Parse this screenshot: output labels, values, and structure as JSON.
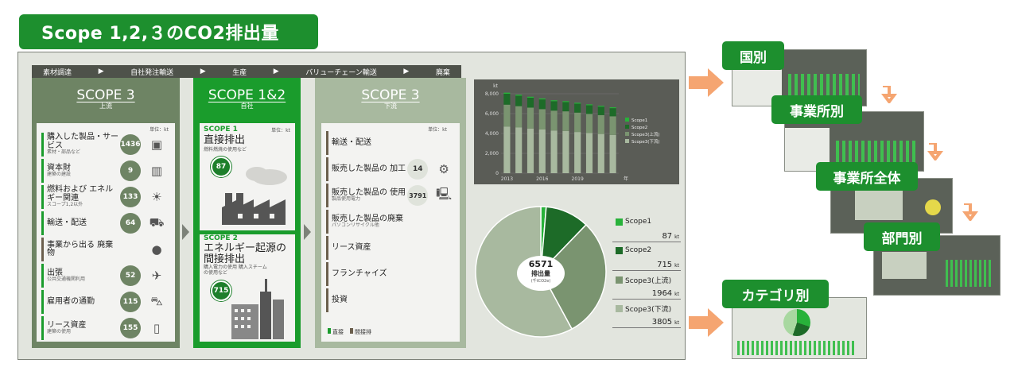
{
  "title": "Scope 1,2,３のCO2排出量",
  "process_steps": [
    "素材調達",
    "自社発注輸送",
    "生産",
    "バリューチェーン輸送",
    "廃棄"
  ],
  "step_arrow": "▶",
  "columns": {
    "upstream": {
      "title": "SCOPE 3",
      "sub": "上流",
      "unit": "単位：kt",
      "rows": [
        {
          "label": "購入した製品・サービス",
          "note": "素材・部品など",
          "value": "1436"
        },
        {
          "label": "資本財",
          "note": "建築の建設",
          "value": "9"
        },
        {
          "label": "燃料および エネルギー関連",
          "note": "スコープ1,2以外",
          "value": "133"
        },
        {
          "label": "輸送・配送",
          "note": "",
          "value": "64"
        },
        {
          "label": "事業から出る 廃棄物",
          "note": "",
          "value": ""
        },
        {
          "label": "出張",
          "note": "公共交通機関利用",
          "value": "52"
        },
        {
          "label": "雇用者の通勤",
          "note": "",
          "value": "115"
        },
        {
          "label": "リース資産",
          "note": "建築の使用",
          "value": "155"
        }
      ]
    },
    "own": {
      "title": "SCOPE 1&2",
      "sub": "自社",
      "unit": "単位：kt",
      "scope1": {
        "tag": "SCOPE 1",
        "label": "直接排出",
        "note": "燃料燃焼の使用など",
        "value": "87"
      },
      "scope2": {
        "tag": "SCOPE 2",
        "label": "エネルギー起源の 間接排出",
        "note": "購入電力の使用 購入スチームの使用など",
        "value": "715"
      }
    },
    "downstream": {
      "title": "SCOPE 3",
      "sub": "下流",
      "unit": "単位：kt",
      "rows": [
        {
          "label": "輸送・配送",
          "note": "",
          "value": ""
        },
        {
          "label": "販売した製品の 加工",
          "note": "",
          "value": "14"
        },
        {
          "label": "販売した製品の 使用",
          "note": "製品使用電力",
          "value": "3791"
        },
        {
          "label": "販売した製品の廃棄",
          "note": "パソコンリサイクル他",
          "value": ""
        },
        {
          "label": "リース資産",
          "note": "",
          "value": ""
        },
        {
          "label": "フランチャイズ",
          "note": "",
          "value": ""
        },
        {
          "label": "投資",
          "note": "",
          "value": ""
        }
      ],
      "legend": [
        "直接",
        "間接排"
      ]
    }
  },
  "chart_data": [
    {
      "type": "bar",
      "stacked": true,
      "title": "",
      "x": [
        2013,
        2014,
        2015,
        2016,
        2017,
        2018,
        2019,
        2020,
        2021,
        2022
      ],
      "x_tick_labels": [
        "2013",
        "2016",
        "2019"
      ],
      "x_unit": "年",
      "y_unit": "kt",
      "ylim": [
        0,
        8000
      ],
      "y_ticks": [
        "0",
        "2,000",
        "4,000",
        "6,000",
        "8,000"
      ],
      "series": [
        {
          "name": "Scope3(下流)",
          "color": "#a8b99f",
          "values": [
            4700,
            4600,
            4500,
            4400,
            4300,
            4250,
            4150,
            4050,
            3950,
            3850
          ]
        },
        {
          "name": "Scope3(上流)",
          "color": "#7a9470",
          "values": [
            2200,
            2150,
            2100,
            2050,
            2000,
            1980,
            1950,
            1920,
            1900,
            1880
          ]
        },
        {
          "name": "Scope2",
          "color": "#1d6b28",
          "values": [
            1100,
            1050,
            1000,
            980,
            950,
            930,
            900,
            870,
            850,
            820
          ]
        },
        {
          "name": "Scope1",
          "color": "#28b23a",
          "values": [
            110,
            105,
            100,
            100,
            95,
            95,
            92,
            90,
            88,
            87
          ]
        }
      ],
      "legend_position": "right",
      "legend_order": [
        "Scope1",
        "Scope2",
        "Scope3(上流)",
        "Scope3(下流)"
      ]
    },
    {
      "type": "pie",
      "center_value": "6571",
      "center_label": "排出量",
      "center_unit": "(千tCO2e)",
      "slices": [
        {
          "name": "Scope1",
          "value": 87,
          "color": "#28b23a"
        },
        {
          "name": "Scope2",
          "value": 715,
          "color": "#1d6b28"
        },
        {
          "name": "Scope3(上流)",
          "value": 1964,
          "color": "#7a9470"
        },
        {
          "name": "Scope3(下流)",
          "value": 3805,
          "color": "#a8b99f"
        }
      ],
      "value_unit": "kt"
    }
  ],
  "legend_values": [
    "87",
    "715",
    "1964",
    "3805"
  ],
  "legend_unit": "kt",
  "views": [
    "国別",
    "事業所別",
    "事業所全体",
    "部門別",
    "カテゴリ別"
  ],
  "colors": {
    "brand": "#1d8f2e",
    "dark": "#6e8464",
    "light": "#a8b99f",
    "arrow": "#f5a571"
  }
}
